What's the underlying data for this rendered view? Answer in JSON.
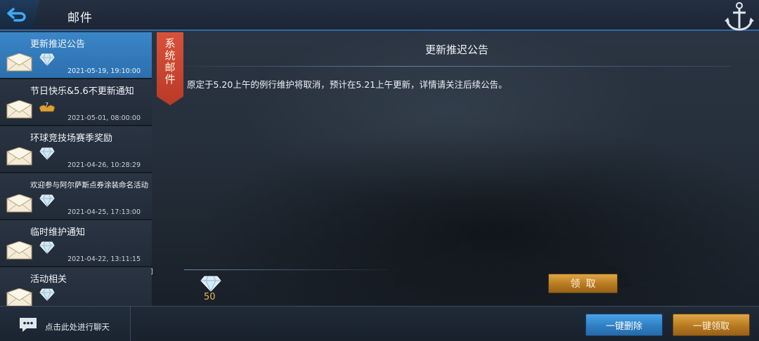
{
  "header": {
    "title": "邮件"
  },
  "mails": [
    {
      "subject": "更新推迟公告",
      "date": "2021-05-19, 19:10:00",
      "reward_icon": "diamond-icon",
      "selected": true
    },
    {
      "subject": "节日快乐&5.6不更新通知",
      "date": "2021-05-01, 08:00:00",
      "reward_icon": "rank-badge-icon",
      "selected": false
    },
    {
      "subject": "环球竞技场赛季奖励",
      "date": "2021-04-26, 10:28:29",
      "reward_icon": "diamond-icon",
      "selected": false
    },
    {
      "subject": "欢迎参与阿尔萨斯点券涂装命名活动",
      "date": "2021-04-25, 17:13:00",
      "reward_icon": "diamond-icon",
      "selected": false
    },
    {
      "subject": "临时维护通知",
      "date": "2021-04-22, 13:11:15",
      "reward_icon": "diamond-icon",
      "selected": false
    },
    {
      "subject": "活动相关",
      "date": "",
      "reward_icon": "diamond-icon",
      "selected": false
    }
  ],
  "category_tag": "系统邮件",
  "message": {
    "title": "更新推迟公告",
    "body": "原定于5.20上午的例行维护将取消，预计在5.21上午更新，详情请关注后续公告。",
    "attachment_count": "50",
    "claim_label": "领取"
  },
  "footer": {
    "chat_prompt": "点击此处进行聊天",
    "delete_all_label": "一键删除",
    "claim_all_label": "一键领取"
  },
  "colors": {
    "accent_blue": "#3a86c7",
    "gold": "#e7b847",
    "tag_red": "#d7523b"
  }
}
